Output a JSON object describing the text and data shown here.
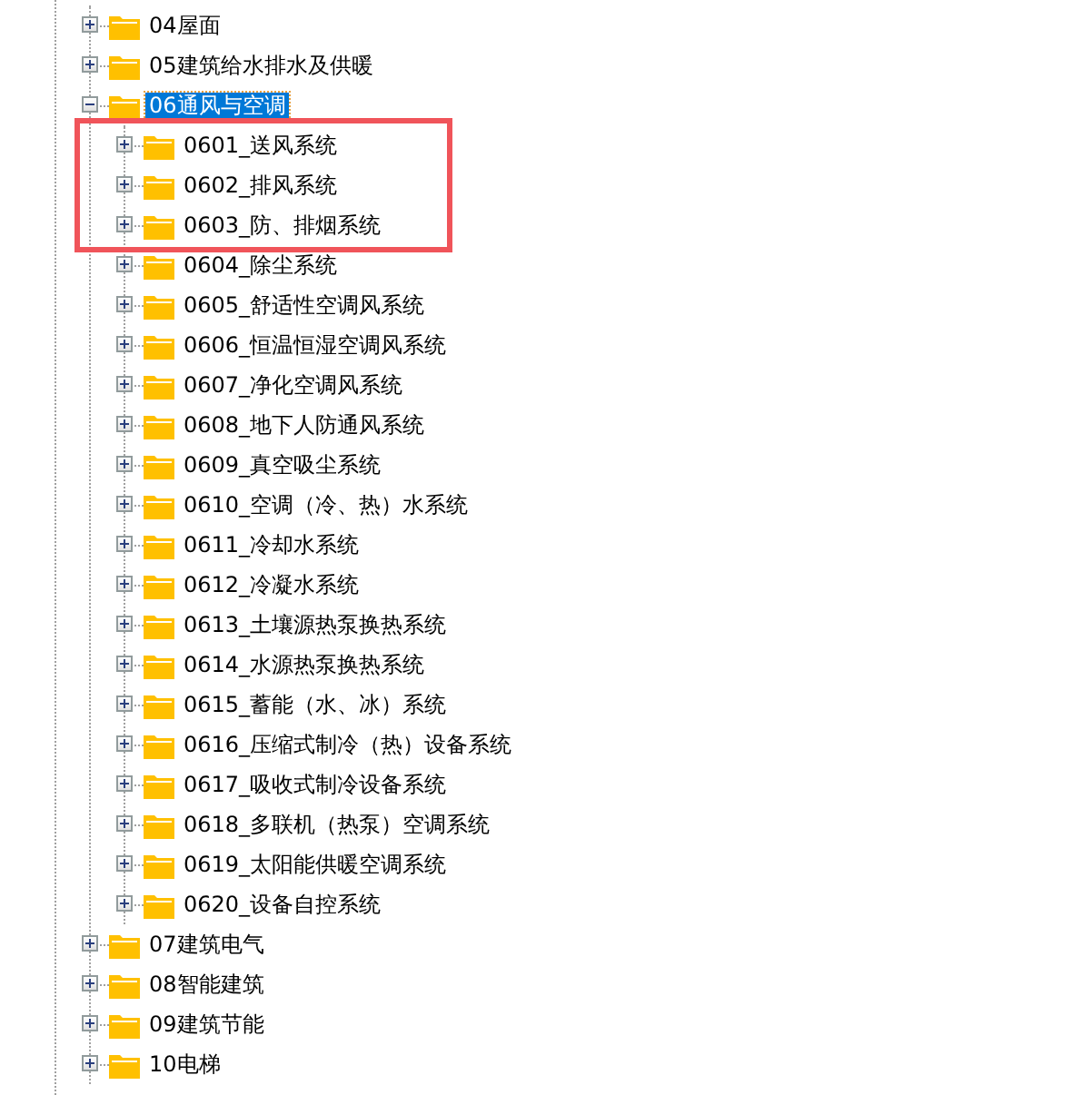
{
  "tree": {
    "items": [
      {
        "label": "04屋面",
        "expanded": false,
        "selected": false
      },
      {
        "label": "05建筑给水排水及供暖",
        "expanded": false,
        "selected": false
      },
      {
        "label": "06通风与空调",
        "expanded": true,
        "selected": true,
        "children": [
          {
            "label": "0601_送风系统",
            "expanded": false,
            "selected": false,
            "highlighted": true
          },
          {
            "label": "0602_排风系统",
            "expanded": false,
            "selected": false,
            "highlighted": true
          },
          {
            "label": "0603_防、排烟系统",
            "expanded": false,
            "selected": false,
            "highlighted": true
          },
          {
            "label": "0604_除尘系统",
            "expanded": false,
            "selected": false,
            "highlighted": false
          },
          {
            "label": "0605_舒适性空调风系统",
            "expanded": false,
            "selected": false,
            "highlighted": false
          },
          {
            "label": "0606_恒温恒湿空调风系统",
            "expanded": false,
            "selected": false,
            "highlighted": false
          },
          {
            "label": "0607_净化空调风系统",
            "expanded": false,
            "selected": false,
            "highlighted": false
          },
          {
            "label": "0608_地下人防通风系统",
            "expanded": false,
            "selected": false,
            "highlighted": false
          },
          {
            "label": "0609_真空吸尘系统",
            "expanded": false,
            "selected": false,
            "highlighted": false
          },
          {
            "label": "0610_空调（冷、热）水系统",
            "expanded": false,
            "selected": false,
            "highlighted": false
          },
          {
            "label": "0611_冷却水系统",
            "expanded": false,
            "selected": false,
            "highlighted": false
          },
          {
            "label": "0612_冷凝水系统",
            "expanded": false,
            "selected": false,
            "highlighted": false
          },
          {
            "label": "0613_土壤源热泵换热系统",
            "expanded": false,
            "selected": false,
            "highlighted": false
          },
          {
            "label": "0614_水源热泵换热系统",
            "expanded": false,
            "selected": false,
            "highlighted": false
          },
          {
            "label": "0615_蓄能（水、冰）系统",
            "expanded": false,
            "selected": false,
            "highlighted": false
          },
          {
            "label": "0616_压缩式制冷（热）设备系统",
            "expanded": false,
            "selected": false,
            "highlighted": false
          },
          {
            "label": "0617_吸收式制冷设备系统",
            "expanded": false,
            "selected": false,
            "highlighted": false
          },
          {
            "label": "0618_多联机（热泵）空调系统",
            "expanded": false,
            "selected": false,
            "highlighted": false
          },
          {
            "label": "0619_太阳能供暖空调系统",
            "expanded": false,
            "selected": false,
            "highlighted": false
          },
          {
            "label": "0620_设备自控系统",
            "expanded": false,
            "selected": false,
            "highlighted": false
          }
        ]
      },
      {
        "label": "07建筑电气",
        "expanded": false,
        "selected": false
      },
      {
        "label": "08智能建筑",
        "expanded": false,
        "selected": false
      },
      {
        "label": "09建筑节能",
        "expanded": false,
        "selected": false
      },
      {
        "label": "10电梯",
        "expanded": false,
        "selected": false
      }
    ]
  }
}
